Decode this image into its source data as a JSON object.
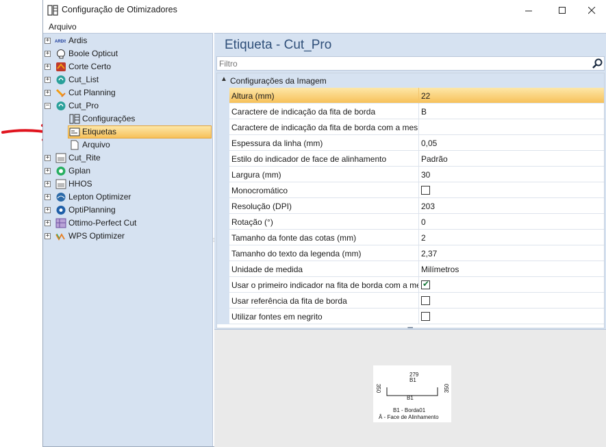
{
  "window": {
    "title": "Configuração de Otimizadores"
  },
  "menu": {
    "file": "Arquivo"
  },
  "tree": {
    "items": [
      {
        "label": "Ardis",
        "expander": "+",
        "icon": "ardis-logo-icon"
      },
      {
        "label": "Boole Opticut",
        "expander": "+",
        "icon": "boole-opticut-icon"
      },
      {
        "label": "Corte Certo",
        "expander": "+",
        "icon": "corte-certo-icon"
      },
      {
        "label": "Cut_List",
        "expander": "+",
        "icon": "cut-list-icon"
      },
      {
        "label": "Cut Planning",
        "expander": "+",
        "icon": "cut-planning-icon"
      },
      {
        "label": "Cut_Pro",
        "expander": "−",
        "icon": "cut-pro-icon"
      },
      {
        "label": "Configurações",
        "icon": "settings-panel-icon"
      },
      {
        "label": "Etiquetas",
        "icon": "label-icon"
      },
      {
        "label": "Arquivo",
        "icon": "file-icon"
      },
      {
        "label": "Cut_Rite",
        "expander": "+",
        "icon": "cut-rite-icon"
      },
      {
        "label": "Gplan",
        "expander": "+",
        "icon": "gplan-icon"
      },
      {
        "label": "HHOS",
        "expander": "+",
        "icon": "hhos-icon"
      },
      {
        "label": "Lepton Optimizer",
        "expander": "+",
        "icon": "lepton-icon"
      },
      {
        "label": "OptiPlanning",
        "expander": "+",
        "icon": "optiplanning-icon"
      },
      {
        "label": "Ottimo-Perfect Cut",
        "expander": "+",
        "icon": "ottimo-icon"
      },
      {
        "label": "WPS Optimizer",
        "expander": "+",
        "icon": "wps-icon"
      }
    ]
  },
  "content": {
    "title": "Etiqueta - Cut_Pro",
    "filter_placeholder": "Filtro",
    "category": "Configurações da Imagem",
    "properties": [
      {
        "name": "Altura (mm)",
        "value": "22"
      },
      {
        "name": "Caractere de indicação da fita de borda",
        "value": "B"
      },
      {
        "name": "Caractere de indicação da fita de borda com a mesm...",
        "value": ""
      },
      {
        "name": "Espessura da linha (mm)",
        "value": "0,05"
      },
      {
        "name": "Estilo do indicador de face de alinhamento",
        "value": "Padrão"
      },
      {
        "name": "Largura (mm)",
        "value": "30"
      },
      {
        "name": "Monocromático",
        "value": "",
        "checkbox": false
      },
      {
        "name": "Resolução (DPI)",
        "value": "203"
      },
      {
        "name": "Rotação (°)",
        "value": "0"
      },
      {
        "name": "Tamanho da fonte das cotas (mm)",
        "value": "2"
      },
      {
        "name": "Tamanho do texto da legenda (mm)",
        "value": "2,37"
      },
      {
        "name": "Unidade de medida",
        "value": "Milímetros"
      },
      {
        "name": "Usar o primeiro indicador na fita de borda com a me...",
        "value": "",
        "checkbox": true
      },
      {
        "name": "Usar referência da fita de borda",
        "value": "",
        "checkbox": false
      },
      {
        "name": "Utilizar fontes em negrito",
        "value": "",
        "checkbox": false
      }
    ]
  },
  "preview": {
    "top_dim": "279",
    "top_edge": "B1",
    "left_dim": "350",
    "right_dim": "350",
    "bottom_edge": "B1",
    "legend_1": "B1 - Borda01",
    "legend_2": "Â - Face de Alinhamento"
  },
  "colors": {
    "selection": "#f7c15a",
    "panel_bg": "#d6e2f1",
    "title_blue": "#30507a",
    "annotation_red": "#e0141e"
  }
}
